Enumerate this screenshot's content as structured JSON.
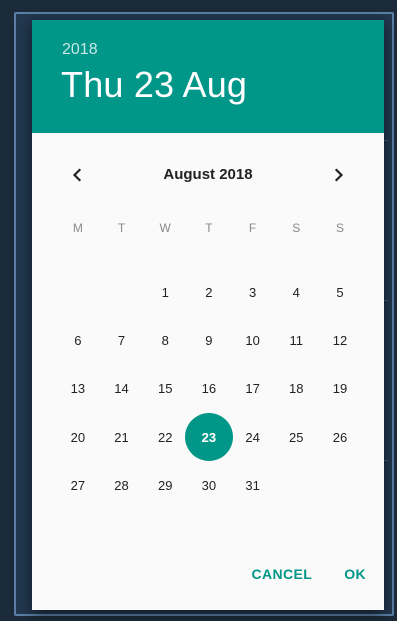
{
  "header": {
    "year": "2018",
    "date": "Thu 23 Aug"
  },
  "calendar": {
    "month_label": "August 2018",
    "weekdays": [
      "M",
      "T",
      "W",
      "T",
      "F",
      "S",
      "S"
    ],
    "weeks": [
      [
        "",
        "",
        "1",
        "2",
        "3",
        "4",
        "5"
      ],
      [
        "6",
        "7",
        "8",
        "9",
        "10",
        "11",
        "12"
      ],
      [
        "13",
        "14",
        "15",
        "16",
        "17",
        "18",
        "19"
      ],
      [
        "20",
        "21",
        "22",
        "23",
        "24",
        "25",
        "26"
      ],
      [
        "27",
        "28",
        "29",
        "30",
        "31",
        "",
        ""
      ]
    ],
    "selected_day": "23"
  },
  "actions": {
    "cancel": "CANCEL",
    "ok": "OK"
  },
  "icons": {
    "prev": "chevron-left-icon",
    "next": "chevron-right-icon"
  },
  "colors": {
    "accent": "#009688",
    "dialog_bg": "#fafafa",
    "text": "#222222"
  }
}
